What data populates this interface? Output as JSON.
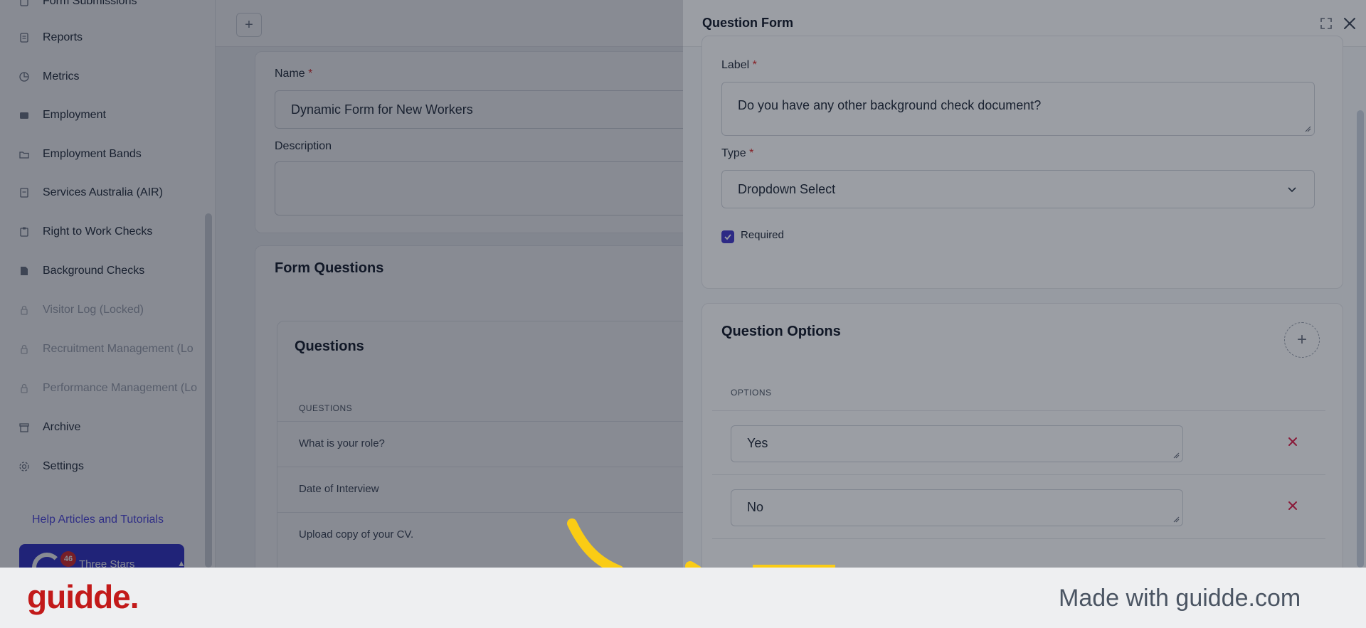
{
  "sidebar": {
    "items": [
      {
        "label": "Form Submissions",
        "icon": "form-icon",
        "locked": false
      },
      {
        "label": "Reports",
        "icon": "report-icon",
        "locked": false
      },
      {
        "label": "Metrics",
        "icon": "pie-chart-icon",
        "locked": false
      },
      {
        "label": "Employment",
        "icon": "card-icon",
        "locked": false
      },
      {
        "label": "Employment Bands",
        "icon": "folder-icon",
        "locked": false
      },
      {
        "label": "Services Australia (AIR)",
        "icon": "document-icon",
        "locked": false
      },
      {
        "label": "Right to Work Checks",
        "icon": "clipboard-icon",
        "locked": false
      },
      {
        "label": "Background Checks",
        "icon": "file-check-icon",
        "locked": false
      },
      {
        "label": "Visitor Log (Locked)",
        "icon": "lock-icon",
        "locked": true
      },
      {
        "label": "Recruitment Management (Lo",
        "icon": "lock-icon",
        "locked": true
      },
      {
        "label": "Performance Management (Lo",
        "icon": "lock-icon",
        "locked": true
      },
      {
        "label": "Archive",
        "icon": "archive-icon",
        "locked": false
      },
      {
        "label": "Settings",
        "icon": "gear-icon",
        "locked": false
      }
    ],
    "help_link": "Help Articles and Tutorials",
    "account": {
      "name": "Three Stars",
      "badge": "46"
    }
  },
  "form": {
    "name_label": "Name",
    "name_value": "Dynamic Form for New Workers",
    "description_label": "Description",
    "description_value": "",
    "questions_section_title": "Form Questions",
    "questions_card_title": "Questions",
    "questions_column": "QUESTIONS",
    "questions": [
      "What is your role?",
      "Date of Interview",
      "Upload copy of your CV."
    ]
  },
  "drawer": {
    "title": "Question Form",
    "label_label": "Label",
    "label_value": "Do you have any other background check document?",
    "type_label": "Type",
    "type_value": "Dropdown Select",
    "required_label": "Required",
    "required_checked": true,
    "options_title": "Question Options",
    "options_column": "OPTIONS",
    "options": [
      "Yes",
      "No"
    ]
  },
  "footer": {
    "brand": "guidde.",
    "made_with": "Made with guidde.com"
  },
  "colors": {
    "accent": "#4338ca",
    "required": "#dc2626",
    "delete": "#e11d48",
    "highlight": "#facc15",
    "brand": "#c21a1a"
  }
}
